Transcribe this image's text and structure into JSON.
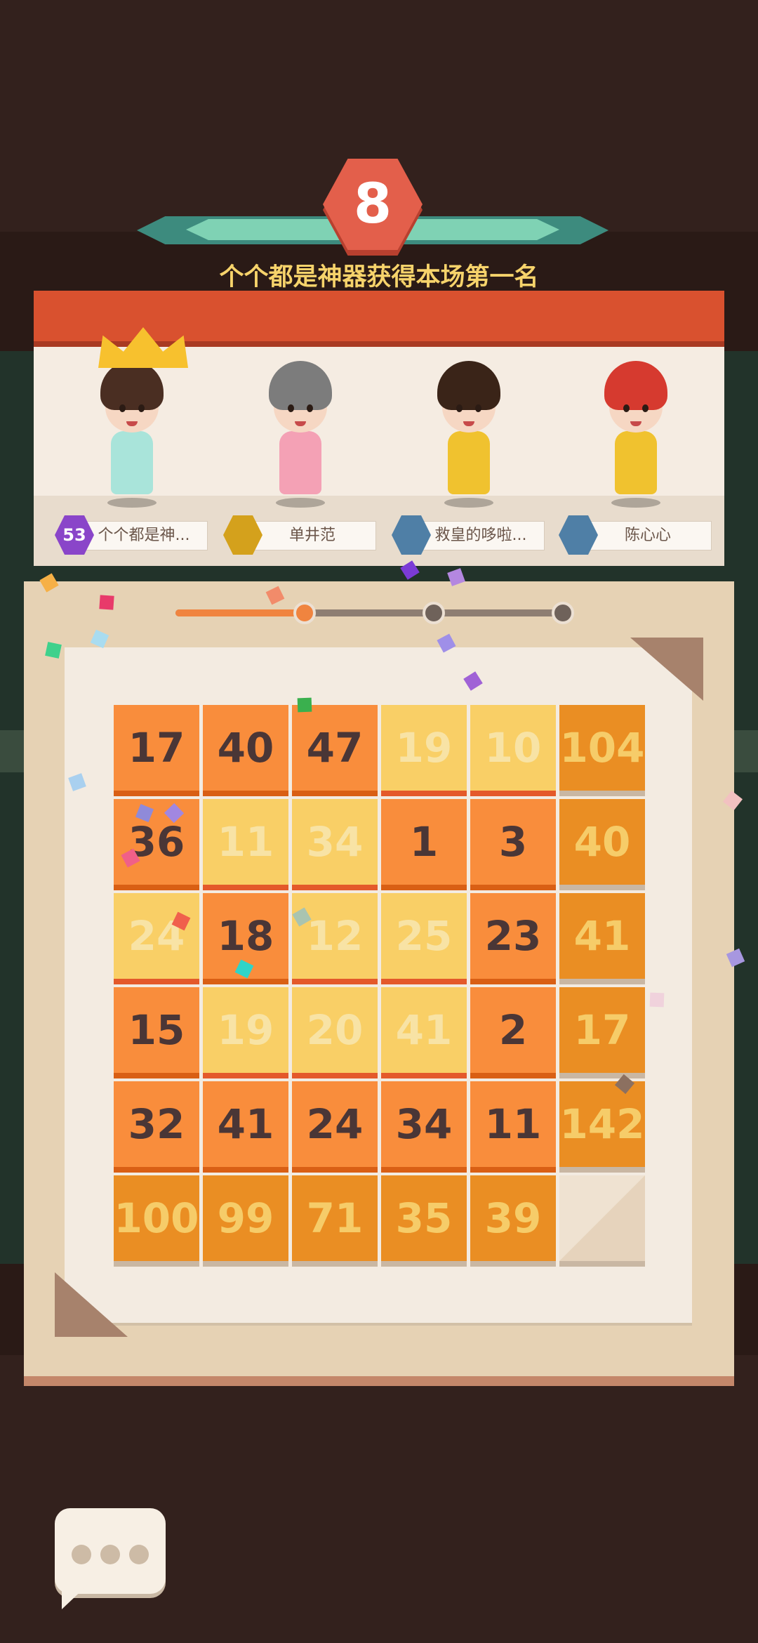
{
  "header": {
    "rank_number": "8",
    "winner_message": "个个都是神器获得本场第一名"
  },
  "players": [
    {
      "name": "个个都是神...",
      "rank_badge": "53",
      "badge_color": "#8a45c9",
      "hair_color": "#4a2e22",
      "outfit_color": "#a9e4da",
      "crowned": true
    },
    {
      "name": "单井范",
      "rank_badge": "",
      "badge_color": "#d4a11c",
      "hair_color": "#7c7c7c",
      "outfit_color": "#f4a1b5",
      "crowned": false
    },
    {
      "name": "救皇的哆啦...",
      "rank_badge": "",
      "badge_color": "#4f7fa6",
      "hair_color": "#3a2418",
      "outfit_color": "#f0c22f",
      "crowned": false
    },
    {
      "name": "陈心心",
      "rank_badge": "",
      "badge_color": "#4f7fa6",
      "hair_color": "#d63a2f",
      "outfit_color": "#f0c22f",
      "crowned": false
    }
  ],
  "progress": {
    "current_stage": 1,
    "total_stages": 3
  },
  "board": {
    "rows": [
      [
        {
          "v": "17",
          "s": "dark"
        },
        {
          "v": "40",
          "s": "dark"
        },
        {
          "v": "47",
          "s": "dark"
        },
        {
          "v": "19",
          "s": "light"
        },
        {
          "v": "10",
          "s": "light"
        },
        {
          "v": "104",
          "s": "gold"
        }
      ],
      [
        {
          "v": "36",
          "s": "dark"
        },
        {
          "v": "11",
          "s": "light"
        },
        {
          "v": "34",
          "s": "light"
        },
        {
          "v": "1",
          "s": "dark"
        },
        {
          "v": "3",
          "s": "dark"
        },
        {
          "v": "40",
          "s": "gold"
        }
      ],
      [
        {
          "v": "24",
          "s": "light"
        },
        {
          "v": "18",
          "s": "dark"
        },
        {
          "v": "12",
          "s": "light"
        },
        {
          "v": "25",
          "s": "light"
        },
        {
          "v": "23",
          "s": "dark"
        },
        {
          "v": "41",
          "s": "gold"
        }
      ],
      [
        {
          "v": "15",
          "s": "dark"
        },
        {
          "v": "19",
          "s": "light"
        },
        {
          "v": "20",
          "s": "light"
        },
        {
          "v": "41",
          "s": "light"
        },
        {
          "v": "2",
          "s": "dark"
        },
        {
          "v": "17",
          "s": "gold"
        }
      ],
      [
        {
          "v": "32",
          "s": "dark"
        },
        {
          "v": "41",
          "s": "dark"
        },
        {
          "v": "24",
          "s": "dark"
        },
        {
          "v": "34",
          "s": "dark"
        },
        {
          "v": "11",
          "s": "dark"
        },
        {
          "v": "142",
          "s": "gold"
        }
      ],
      [
        {
          "v": "100",
          "s": "gold"
        },
        {
          "v": "99",
          "s": "gold"
        },
        {
          "v": "71",
          "s": "gold"
        },
        {
          "v": "35",
          "s": "gold"
        },
        {
          "v": "39",
          "s": "gold"
        },
        {
          "v": "",
          "s": "empty"
        }
      ]
    ]
  },
  "chat": {
    "icon": "chat-bubble-icon"
  }
}
